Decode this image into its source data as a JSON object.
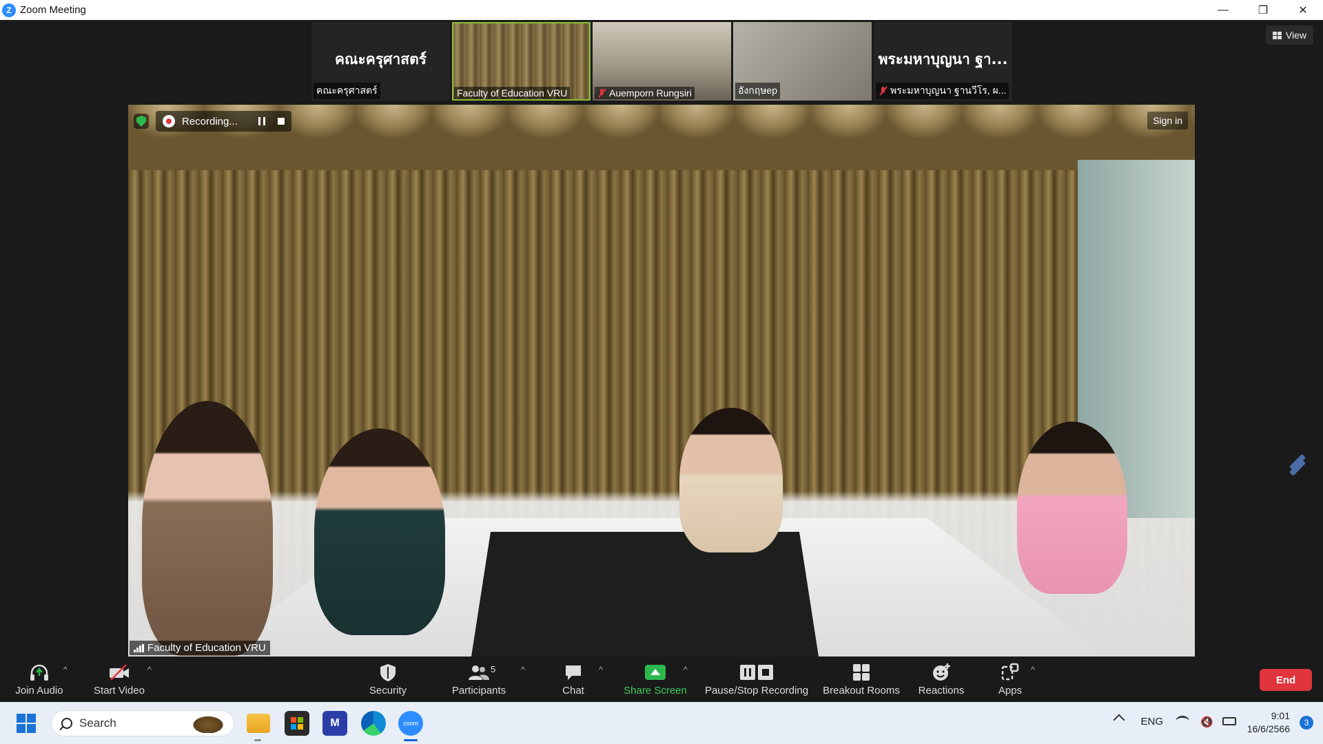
{
  "window": {
    "app_icon": "Z",
    "title": "Zoom Meeting",
    "controls": [
      "—",
      "❐",
      "✕"
    ]
  },
  "thumbnails": [
    {
      "big_name": "คณะครุศาสตร์",
      "label": "คณะครุศาสตร์",
      "muted": false,
      "video": false
    },
    {
      "big_name": "",
      "label": "Faculty of Education VRU",
      "muted": false,
      "video": true,
      "active": true
    },
    {
      "big_name": "",
      "label": "Auemporn Rungsiri",
      "muted": true,
      "video": true
    },
    {
      "big_name": "",
      "label": "อังกฤษep",
      "muted": false,
      "video": true
    },
    {
      "big_name": "พระมหาบุญนา ฐา...",
      "label": "พระมหาบุญนา ฐานวีโร, ผ...",
      "muted": true,
      "video": false
    }
  ],
  "view_button": "View",
  "main_video": {
    "recording_label": "Recording...",
    "sign_in": "Sign in",
    "speaker_label": "Faculty of Education VRU"
  },
  "toolbar": {
    "join_audio": "Join Audio",
    "start_video": "Start Video",
    "security": "Security",
    "participants": "Participants",
    "participants_count": "5",
    "chat": "Chat",
    "share_screen": "Share Screen",
    "pause_stop_recording": "Pause/Stop Recording",
    "breakout_rooms": "Breakout Rooms",
    "reactions": "Reactions",
    "apps": "Apps",
    "end": "End",
    "caret": "^"
  },
  "taskbar": {
    "search_placeholder": "Search",
    "vs_label": "M",
    "zoom_label": "zoom",
    "language": "ENG",
    "speaker_glyph": "🔇",
    "time": "9:01",
    "date": "16/6/2566",
    "notification_count": "3"
  },
  "colors": {
    "accent_green": "#2db84d",
    "end_red": "#e0353c",
    "zoom_blue": "#2d8cff"
  }
}
